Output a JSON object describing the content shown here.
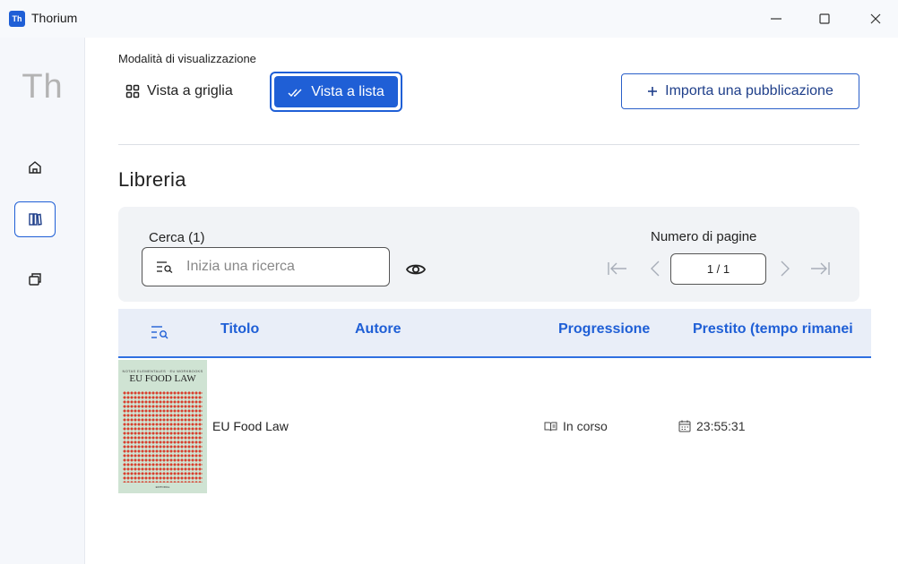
{
  "window": {
    "app_icon_text": "Th",
    "title": "Thorium"
  },
  "sidebar": {
    "logo": "Th",
    "items": [
      {
        "icon": "home-icon"
      },
      {
        "icon": "library-icon",
        "active": true
      },
      {
        "icon": "catalogs-icon"
      }
    ]
  },
  "view_mode": {
    "label": "Modalità di visualizzazione",
    "grid_label": "Vista a griglia",
    "list_label": "Vista a lista",
    "selected": "list"
  },
  "import_button": {
    "label": "Importa una pubblicazione"
  },
  "library": {
    "title": "Libreria"
  },
  "search": {
    "label": "Cerca (1)",
    "placeholder": "Inizia una ricerca",
    "value": ""
  },
  "pagination": {
    "label": "Numero di pagine",
    "current": "1 / 1"
  },
  "table": {
    "headers": [
      "Titolo",
      "Autore",
      "Progressione",
      "Prestito (tempo rimanei"
    ],
    "rows": [
      {
        "cover": {
          "subtitle": "NOTAS ELEMENTALES · EU WORKBOOKS",
          "title": "EU FOOD LAW",
          "footer": "EDITORIAL"
        },
        "title": "EU Food Law",
        "author": "",
        "progress": "In corso",
        "loan": "23:55:31"
      }
    ]
  },
  "colors": {
    "accent": "#1f5fd6",
    "header_bg": "#e9eef8",
    "panel_bg": "#f1f3f6",
    "sidebar_bg": "#f5f7fb",
    "cover_bg": "#cfe3d3",
    "cover_dots": "#d8402f"
  }
}
